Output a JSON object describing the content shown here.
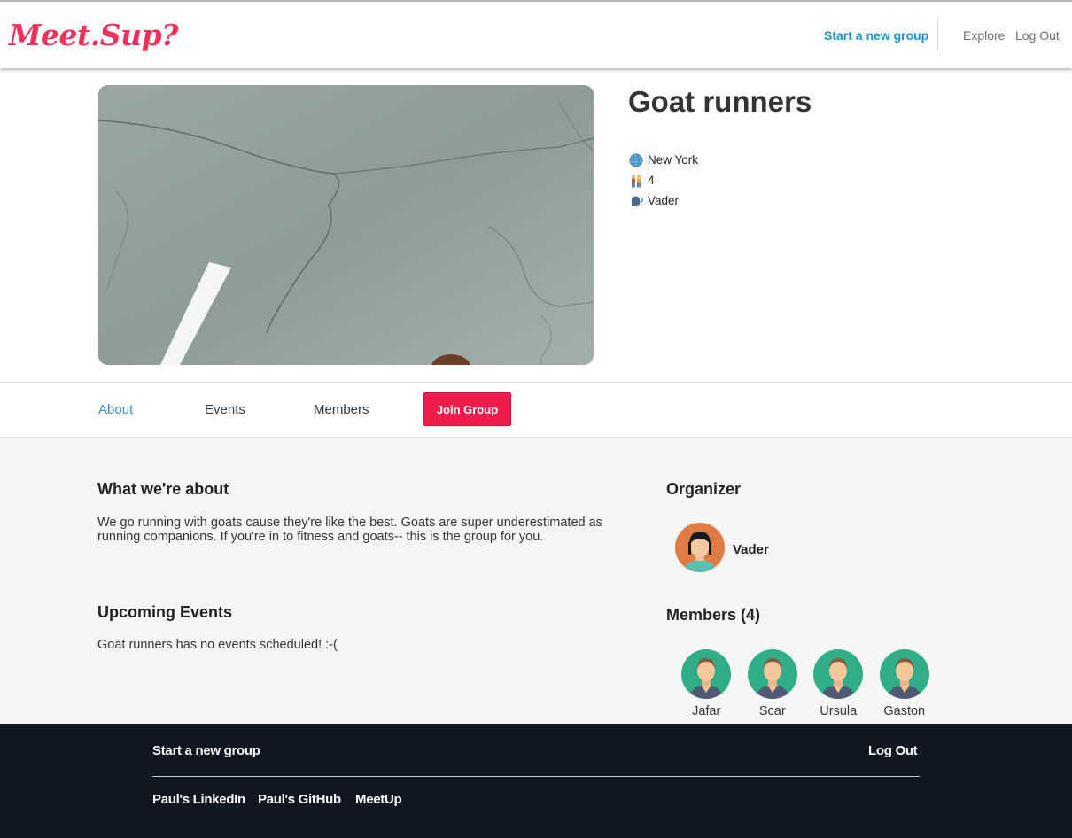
{
  "header": {
    "logo": "Meet.Sup?",
    "start_group": "Start a new group",
    "explore": "Explore",
    "log_out": "Log Out"
  },
  "group": {
    "title": "Goat runners",
    "location": "New York",
    "member_count": "4",
    "organizer": "Vader"
  },
  "tabs": {
    "about": "About",
    "events": "Events",
    "members": "Members",
    "join": "Join Group"
  },
  "about": {
    "heading": "What we're about",
    "text": "We go running with goats cause they're like the best. Goats are super underestimated as running companions. If you're in to fitness and goats-- this is the group for you."
  },
  "events": {
    "heading": "Upcoming Events",
    "empty": "Goat runners has no events scheduled! :-("
  },
  "organizer_panel": {
    "heading": "Organizer",
    "name": "Vader"
  },
  "members_panel": {
    "heading": "Members (4)",
    "members": [
      "Jafar",
      "Scar",
      "Ursula",
      "Gaston"
    ]
  },
  "footer": {
    "start_group": "Start a new group",
    "log_out": "Log Out",
    "links": [
      "Paul's LinkedIn",
      "Paul's GitHub",
      "MeetUp"
    ]
  },
  "colors": {
    "brand": "#f0315c",
    "join_button": "#ee1c4b",
    "link_blue": "#1e93c8",
    "footer_bg": "#0f1722"
  },
  "icons": {
    "location": "globe-icon",
    "members": "people-icon",
    "organizer": "speaking-head-icon"
  }
}
